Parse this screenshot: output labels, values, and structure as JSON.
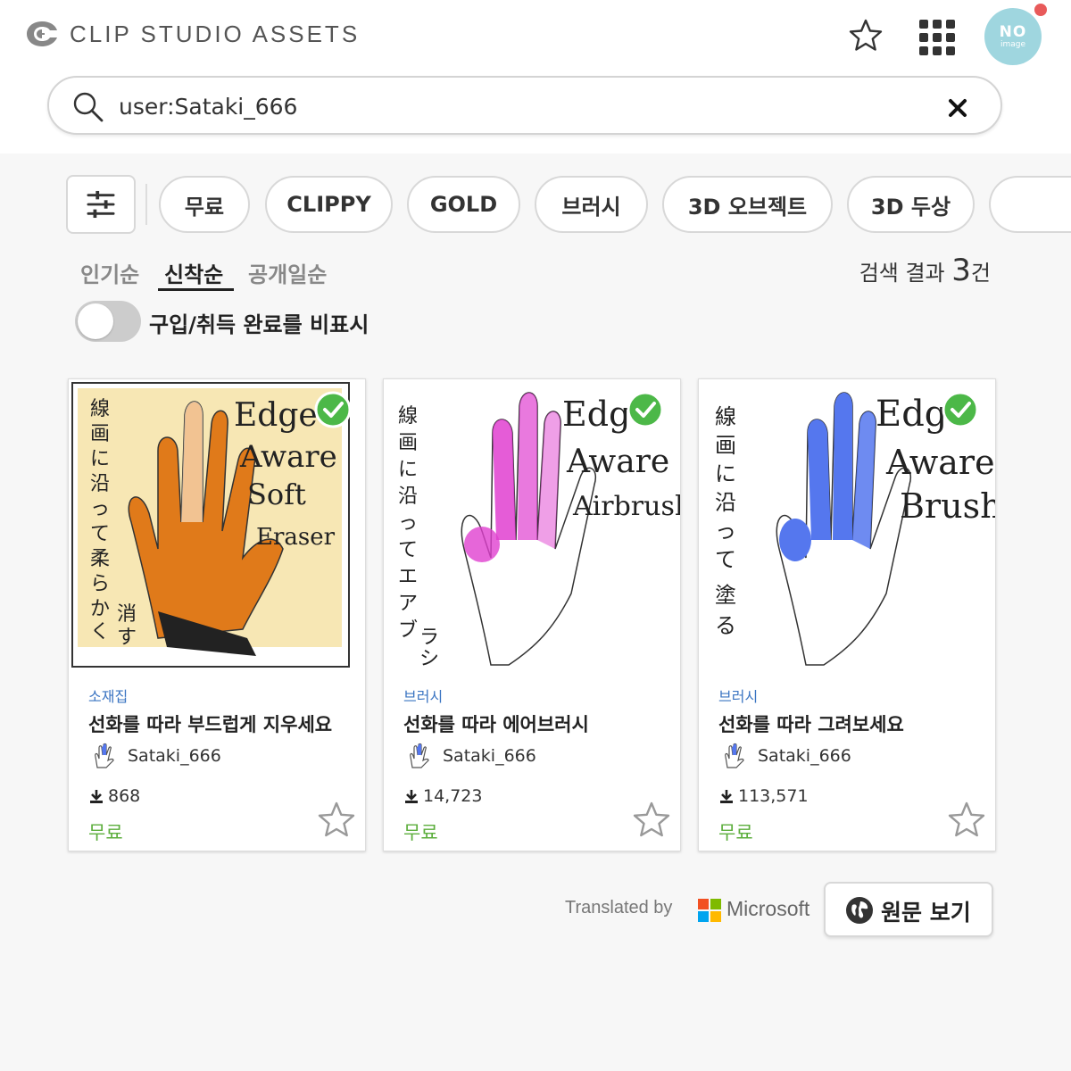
{
  "header": {
    "app_title": "CLIP STUDIO ASSETS",
    "avatar_text_big": "NO",
    "avatar_text_small": "image"
  },
  "search": {
    "value": "user:Sataki_666"
  },
  "filters": {
    "chips": [
      "무료",
      "CLIPPY",
      "GOLD",
      "브러시",
      "3D 오브젝트",
      "3D 두상"
    ]
  },
  "sort": {
    "tabs": [
      "인기순",
      "신착순",
      "공개일순"
    ],
    "active": "신착순"
  },
  "results": {
    "prefix": "검색 결과 ",
    "count": "3",
    "suffix": "건"
  },
  "toggle": {
    "label": "구입/취득 완료를 비표시",
    "on": false
  },
  "cards": [
    {
      "category": "소재집",
      "title": "선화를 따라 부드럽게 지우세요",
      "author": "Sataki_666",
      "downloads": "868",
      "price": "무료",
      "thumb_jp": "線画に沿って柔らかく消す",
      "thumb_en": [
        "Edge",
        "Aware",
        "Soft",
        "Eraser"
      ],
      "hand_color": "#e07a1a",
      "thumb_bg": "#f7e7b4",
      "owned": true
    },
    {
      "category": "브러시",
      "title": "선화를 따라 에어브러시",
      "author": "Sataki_666",
      "downloads": "14,723",
      "price": "무료",
      "thumb_jp": "線画に沿ってエアブラシ",
      "thumb_en": [
        "Edge",
        "Aware",
        "Airbrush"
      ],
      "hand_color": "#e040d0",
      "thumb_bg": "#ffffff",
      "owned": true
    },
    {
      "category": "브러시",
      "title": "선화를 따라 그려보세요",
      "author": "Sataki_666",
      "downloads": "113,571",
      "price": "무료",
      "thumb_jp": "線画に沿って塗る",
      "thumb_en": [
        "Edge",
        "Aware",
        "Brush"
      ],
      "hand_color": "#5577ee",
      "thumb_bg": "#ffffff",
      "owned": true
    }
  ],
  "footer": {
    "translated_by": "Translated by",
    "microsoft": "Microsoft",
    "original_button": "원문 보기"
  },
  "colors": {
    "price_green": "#5cae3c",
    "category_blue": "#3a74c2",
    "check_green": "#4cb848",
    "notif_red": "#e85a5a"
  },
  "icons": [
    "clip-studio-logo-icon",
    "star-icon",
    "apps-grid-icon",
    "search-icon",
    "close-icon",
    "filter-sliders-icon",
    "check-icon",
    "download-icon",
    "globe-icon",
    "microsoft-logo-icon"
  ]
}
